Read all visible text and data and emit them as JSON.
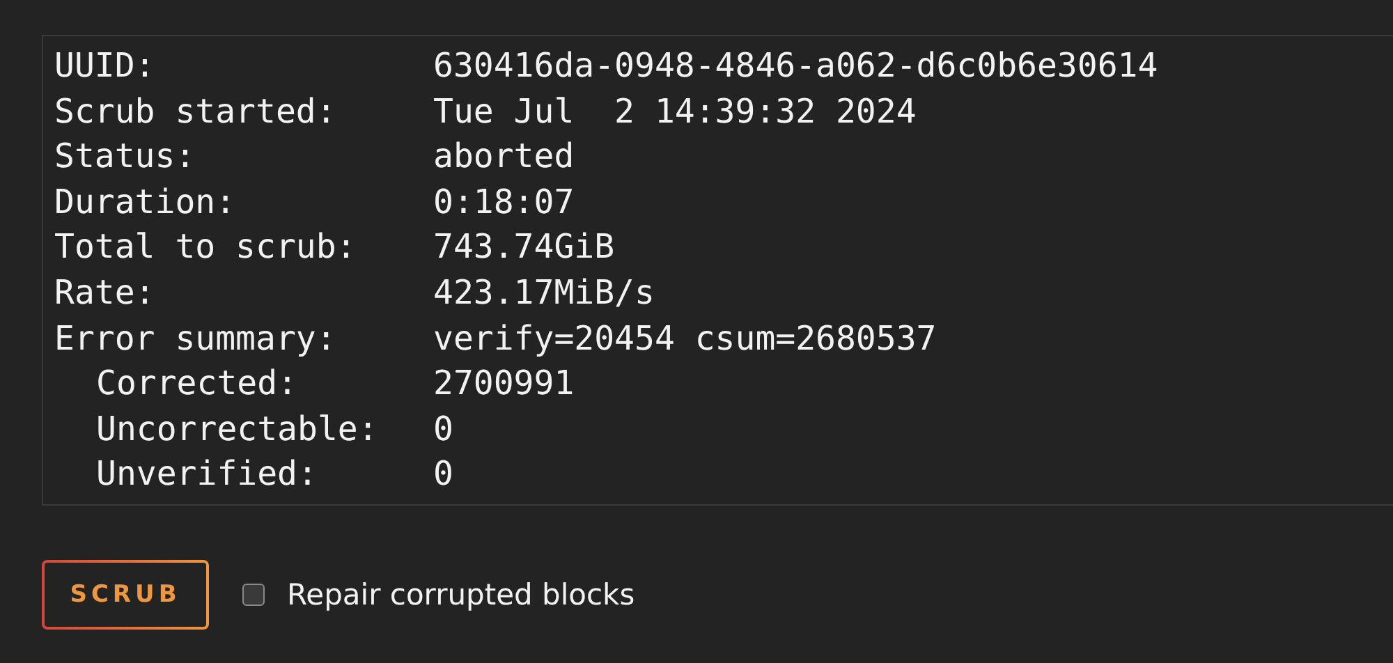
{
  "scrub_report": [
    {
      "label": "UUID:",
      "value": "630416da-0948-4846-a062-d6c0b6e30614"
    },
    {
      "label": "Scrub started:",
      "value": "Tue Jul  2 14:39:32 2024"
    },
    {
      "label": "Status:",
      "value": "aborted"
    },
    {
      "label": "Duration:",
      "value": "0:18:07"
    },
    {
      "label": "Total to scrub:",
      "value": "743.74GiB"
    },
    {
      "label": "Rate:",
      "value": "423.17MiB/s"
    },
    {
      "label": "Error summary:",
      "value": "verify=20454 csum=2680537",
      "children": [
        {
          "label": "Corrected:",
          "value": "2700991"
        },
        {
          "label": "Uncorrectable:",
          "value": "0"
        },
        {
          "label": "Unverified:",
          "value": "0"
        }
      ]
    }
  ],
  "scrub_button": "SCRUB",
  "repair_option": {
    "label": "Repair corrupted blocks",
    "checked": false
  }
}
